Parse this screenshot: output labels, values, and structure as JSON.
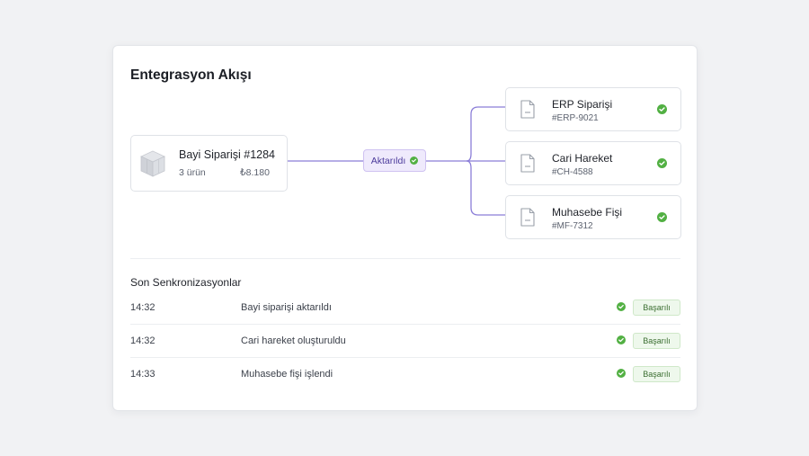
{
  "title": "Entegrasyon Akışı",
  "source": {
    "name": "Bayi Siparişi #1284",
    "count": "3 ürün",
    "total": "₺8.180",
    "icon": "box-icon"
  },
  "chip": {
    "label": "Aktarıldı",
    "icon": "check-circle-icon"
  },
  "targets": [
    {
      "name": "ERP Siparişi",
      "code": "#ERP-9021",
      "icon": "document-icon",
      "status_icon": "check-circle-icon"
    },
    {
      "name": "Cari Hareket",
      "code": "#CH-4588",
      "icon": "document-icon",
      "status_icon": "check-circle-icon"
    },
    {
      "name": "Muhasebe Fişi",
      "code": "#MF-7312",
      "icon": "document-icon",
      "status_icon": "check-circle-icon"
    }
  ],
  "recent": {
    "title": "Son Senkronizasyonlar",
    "rows": [
      {
        "time": "14:32",
        "desc": "Bayi siparişi aktarıldı",
        "status": "Başarılı"
      },
      {
        "time": "14:32",
        "desc": "Cari hareket oluşturuldu",
        "status": "Başarılı"
      },
      {
        "time": "14:33",
        "desc": "Muhasebe fişi işlendi",
        "status": "Başarılı"
      }
    ]
  },
  "colors": {
    "accent": "#6f5bd0",
    "success": "#52b043",
    "chip_bg": "#efeafc"
  }
}
